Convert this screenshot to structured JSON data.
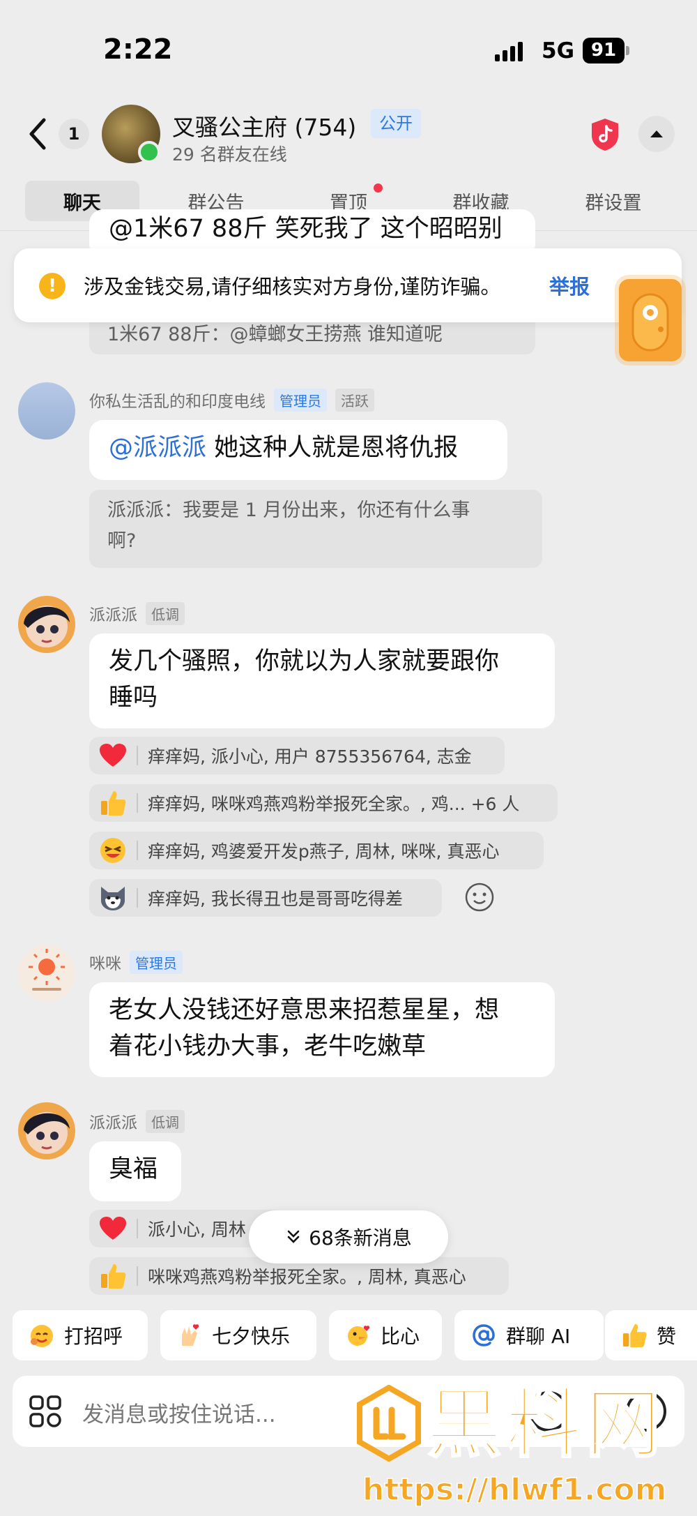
{
  "status": {
    "time": "2:22",
    "network": "5G",
    "battery": "91"
  },
  "header": {
    "back_count": "1",
    "group_name": "叉骚公主府 (754)",
    "public_label": "公开",
    "online_text": "29 名群友在线"
  },
  "tabs": [
    {
      "label": "聊天",
      "active": true
    },
    {
      "label": "群公告"
    },
    {
      "label": "置顶",
      "has_dot": true
    },
    {
      "label": "群收藏"
    },
    {
      "label": "群设置"
    }
  ],
  "warning": {
    "text": "涉及金钱交易,请仔细核实对方身份,谨防诈骗。",
    "link": "举报"
  },
  "top_partial": {
    "bubble": "@1米67 88斤 笑死我了 这个昭昭别",
    "quote": "1米67 88斤：@蟑螂女王捞燕 谁知道呢"
  },
  "messages": [
    {
      "sender": "你私生活乱的和印度电线",
      "role": "管理员",
      "tag": "活跃",
      "mention": "@派派派",
      "text": "她这种人就是恩将仇报",
      "quote_line1": "派派派：我要是 1 月份出来，你还有什么事",
      "quote_line2": "啊?"
    },
    {
      "sender": "派派派",
      "tag": "低调",
      "text_line1": "发几个骚照，你就以为人家就要跟你",
      "text_line2": "睡吗",
      "reactions": [
        {
          "emoji": "heart",
          "users": "痒痒妈, 派小心, 用户 8755356764, 志金"
        },
        {
          "emoji": "thumbs-up",
          "users": "痒痒妈, 咪咪鸡燕鸡粉举报死全家。, 鸡... +6 人"
        },
        {
          "emoji": "laughing-face",
          "users": "痒痒妈, 鸡婆爱开发p燕子, 周林, 咪咪, 真恶心"
        },
        {
          "emoji": "husky-face",
          "users": "痒痒妈, 我长得丑也是哥哥吃得差"
        }
      ]
    },
    {
      "sender": "咪咪",
      "role": "管理员",
      "text_line1": "老女人没钱还好意思来招惹星星，想",
      "text_line2": "着花小钱办大事，老牛吃嫩草"
    },
    {
      "sender": "派派派",
      "tag": "低调",
      "text": "臭福",
      "reactions": [
        {
          "emoji": "heart",
          "users": "派小心, 周林"
        },
        {
          "emoji": "thumbs-up",
          "users": "咪咪鸡燕鸡粉举报死全家。, 周林, 真恶心"
        }
      ]
    }
  ],
  "new_messages": "68条新消息",
  "quick_replies": [
    {
      "label": "打招呼",
      "icon": "wave-face-icon"
    },
    {
      "label": "七夕快乐",
      "icon": "love-hand-icon"
    },
    {
      "label": "比心",
      "icon": "duck-heart-icon"
    },
    {
      "label": "群聊 AI",
      "icon": "at-icon"
    },
    {
      "label": "赞",
      "icon": "thumbs-up-icon"
    }
  ],
  "input": {
    "placeholder": "发消息或按住说话..."
  },
  "watermark": {
    "title": "黑料网",
    "url": "https://hlwf1.com"
  },
  "colors": {
    "accent": "#2d6fd8",
    "warning": "#f7b51b",
    "online": "#33c14d",
    "watermark": "#f5a623"
  }
}
